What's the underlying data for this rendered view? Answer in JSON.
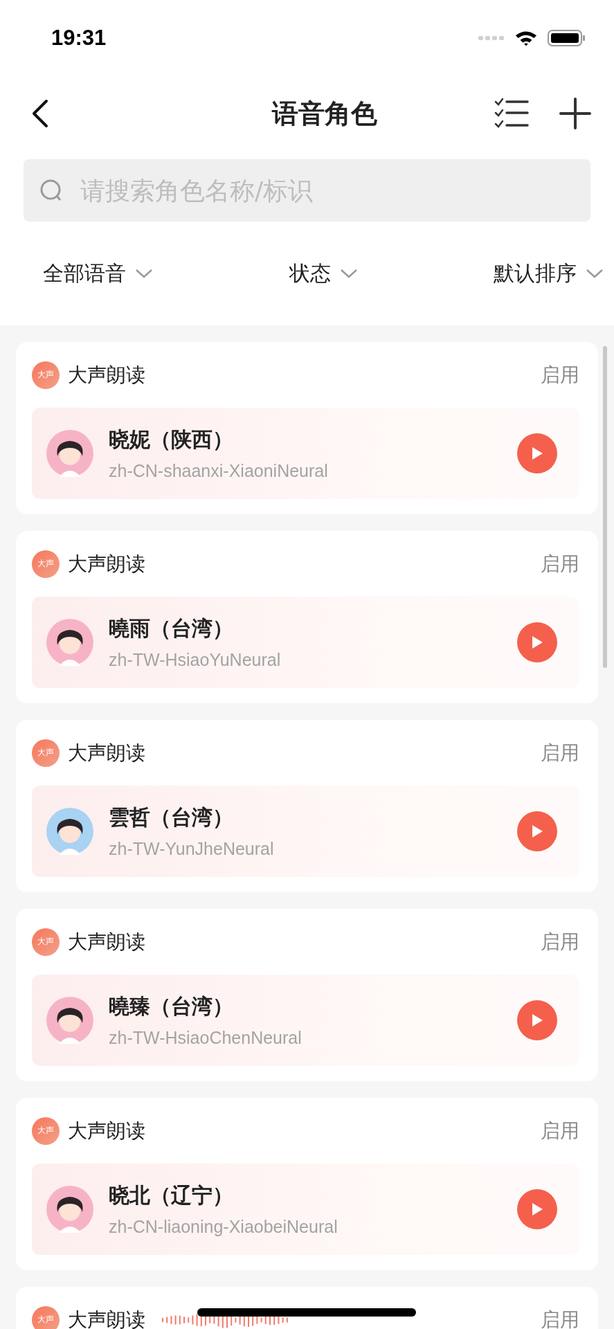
{
  "status_bar": {
    "time": "19:31"
  },
  "nav": {
    "title": "语音角色"
  },
  "search": {
    "placeholder": "请搜索角色名称/标识"
  },
  "filters": [
    {
      "label": "全部语音"
    },
    {
      "label": "状态"
    },
    {
      "label": "默认排序"
    }
  ],
  "cards": [
    {
      "badge": "大声",
      "source": "大声朗读",
      "status": "启用",
      "playing": false,
      "color": "#f7b3c6",
      "name": "晓妮（陕西）",
      "voice_id": "zh-CN-shaanxi-XiaoniNeural"
    },
    {
      "badge": "大声",
      "source": "大声朗读",
      "status": "启用",
      "playing": false,
      "color": "#f7b3c6",
      "name": "曉雨（台湾）",
      "voice_id": "zh-TW-HsiaoYuNeural"
    },
    {
      "badge": "大声",
      "source": "大声朗读",
      "status": "启用",
      "playing": false,
      "color": "#a9d3f2",
      "name": "雲哲（台湾）",
      "voice_id": "zh-TW-YunJheNeural"
    },
    {
      "badge": "大声",
      "source": "大声朗读",
      "status": "启用",
      "playing": false,
      "color": "#f7b3c6",
      "name": "曉臻（台湾）",
      "voice_id": "zh-TW-HsiaoChenNeural"
    },
    {
      "badge": "大声",
      "source": "大声朗读",
      "status": "启用",
      "playing": false,
      "color": "#f7b3c6",
      "name": "晓北（辽宁）",
      "voice_id": "zh-CN-liaoning-XiaobeiNeural"
    },
    {
      "badge": "大声",
      "source": "大声朗读",
      "status": "启用",
      "playing": true
    }
  ]
}
